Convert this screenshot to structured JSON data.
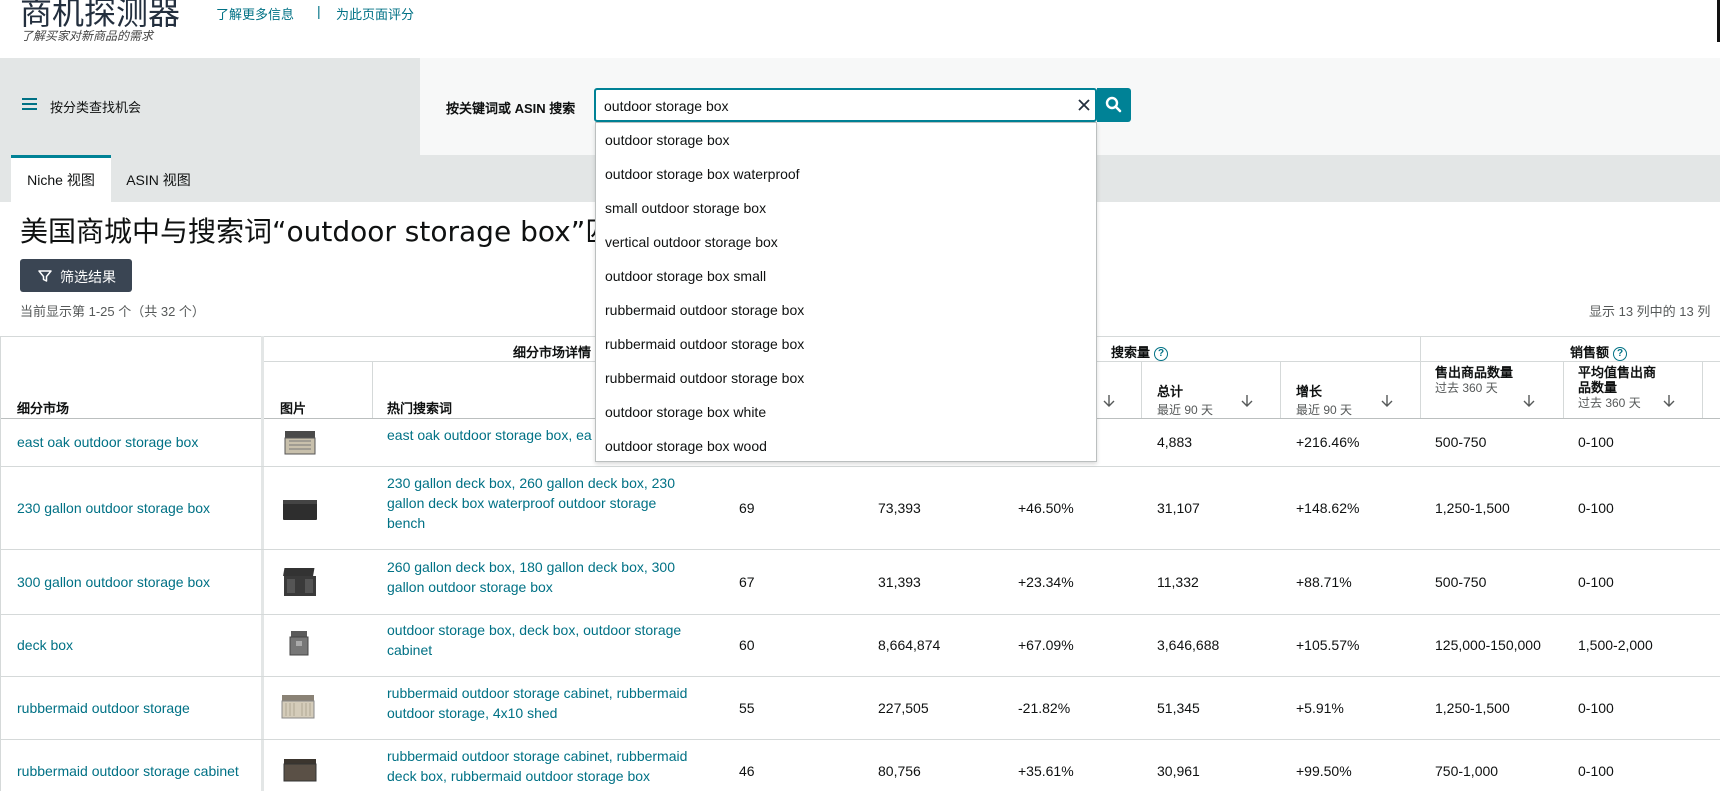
{
  "header": {
    "title": "商机探测器",
    "subtitle": "了解买家对新商品的需求",
    "learn_more": "了解更多信息",
    "separator": "|",
    "rate_page": "为此页面评分"
  },
  "category_nav": {
    "label": "按分类查找机会"
  },
  "search": {
    "label": "按关键词或 ASIN 搜索",
    "value": "outdoor storage box",
    "clear_icon": "close-icon",
    "button_icon": "search-icon"
  },
  "autocomplete": [
    "outdoor storage box",
    "outdoor storage box waterproof",
    "small outdoor storage box",
    "vertical outdoor storage box",
    "outdoor storage box small",
    "rubbermaid outdoor storage box",
    "rubbermaid outdoor storage box",
    "rubbermaid outdoor storage box",
    "outdoor storage box white",
    "outdoor storage box wood"
  ],
  "tabs": [
    {
      "label": "Niche 视图",
      "active": true
    },
    {
      "label": "ASIN 视图",
      "active": false
    }
  ],
  "results": {
    "heading": "美国商城中与搜索词“outdoor storage box”匹配",
    "filter_label": "筛选结果",
    "showing": "当前显示第 1-25 个（共 32 个）",
    "columns_info": "显示 13 列中的 13 列"
  },
  "table": {
    "group_headers": {
      "niche_details": "细分市场详情",
      "search_volume": "搜索量",
      "sales": "销售额"
    },
    "columns": {
      "niche": "细分市场",
      "image": "图片",
      "top_terms": "热门搜索词",
      "total": "总计",
      "total_sub": "最近 90 天",
      "growth": "增长",
      "growth_sub": "最近 90 天",
      "units_sold": "售出商品数量",
      "units_sold_sub": "过去 360 天",
      "avg_units": "平均值售出商品数量",
      "avg_units_sub": "过去 360 天"
    },
    "rows": [
      {
        "niche": "east oak outdoor storage box",
        "terms": "east oak outdoor storage box, ea",
        "score": "",
        "sv360": "",
        "sv360_growth": "",
        "total": "4,883",
        "growth": "+216.46%",
        "units": "500-750",
        "avg": "0-100"
      },
      {
        "niche": "230 gallon outdoor storage box",
        "terms": "230 gallon deck box, 260 gallon deck box, 230 gallon deck box waterproof outdoor storage bench",
        "score": "69",
        "sv360": "73,393",
        "sv360_growth": "+46.50%",
        "total": "31,107",
        "growth": "+148.62%",
        "units": "1,250-1,500",
        "avg": "0-100"
      },
      {
        "niche": "300 gallon outdoor storage box",
        "terms": "260 gallon deck box, 180 gallon deck box, 300 gallon outdoor storage box",
        "score": "67",
        "sv360": "31,393",
        "sv360_growth": "+23.34%",
        "total": "11,332",
        "growth": "+88.71%",
        "units": "500-750",
        "avg": "0-100"
      },
      {
        "niche": "deck box",
        "terms": "outdoor storage box, deck box, outdoor storage cabinet",
        "score": "60",
        "sv360": "8,664,874",
        "sv360_growth": "+67.09%",
        "total": "3,646,688",
        "growth": "+105.57%",
        "units": "125,000-150,000",
        "avg": "1,500-2,000"
      },
      {
        "niche": "rubbermaid outdoor storage",
        "terms": "rubbermaid outdoor storage cabinet, rubbermaid outdoor storage, 4x10 shed",
        "score": "55",
        "sv360": "227,505",
        "sv360_growth": "-21.82%",
        "total": "51,345",
        "growth": "+5.91%",
        "units": "1,250-1,500",
        "avg": "0-100"
      },
      {
        "niche": "rubbermaid outdoor storage cabinet",
        "terms": "rubbermaid outdoor storage cabinet, rubbermaid deck box, rubbermaid outdoor storage box",
        "score": "46",
        "sv360": "80,756",
        "sv360_growth": "+35.61%",
        "total": "30,961",
        "growth": "+99.50%",
        "units": "750-1,000",
        "avg": "0-100"
      }
    ]
  },
  "colors": {
    "accent": "#007185",
    "teal": "#008296",
    "dark_button": "#3a4553"
  }
}
